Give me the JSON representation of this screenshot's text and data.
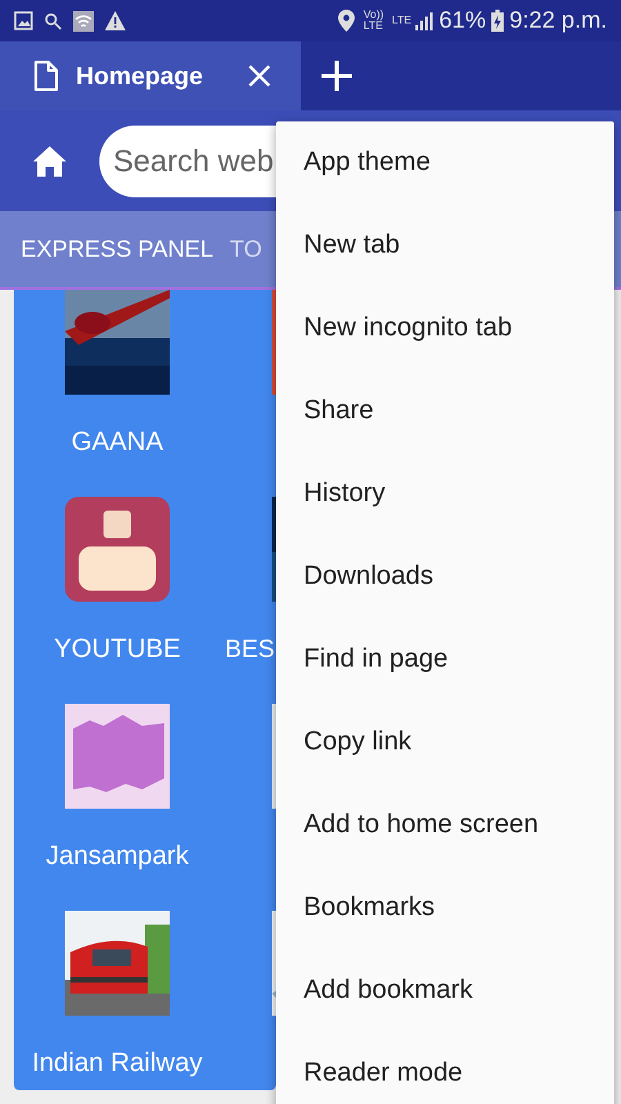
{
  "status_bar": {
    "network_labels": [
      "Vo))",
      "LTE",
      "LTE"
    ],
    "battery": "61%",
    "time": "9:22 p.m."
  },
  "tabs": [
    {
      "label": "Homepage",
      "selected": true
    }
  ],
  "toolbar": {
    "search": {
      "placeholder": "Search web"
    }
  },
  "panel_tabs": [
    {
      "label": "EXPRESS PANEL",
      "selected": true
    },
    {
      "label": "TO",
      "selected": false
    }
  ],
  "tiles": [
    {
      "label": "GAANA",
      "kind": "picture"
    },
    {
      "kind": "picture"
    },
    {
      "label": "YOUTUBE",
      "kind": "picture"
    },
    {
      "label": "BES",
      "kind": "picture"
    },
    {
      "label": "Jansampark",
      "kind": "picture"
    },
    {
      "kind": "picture"
    },
    {
      "label": "Indian Railway",
      "kind": "picture"
    },
    {
      "kind": "picture"
    }
  ],
  "menu": {
    "items": [
      "App theme",
      "New tab",
      "New incognito tab",
      "Share",
      "History",
      "Downloads",
      "Find in page",
      "Copy link",
      "Add to home screen",
      "Bookmarks",
      "Add bookmark",
      "Reader mode"
    ]
  }
}
